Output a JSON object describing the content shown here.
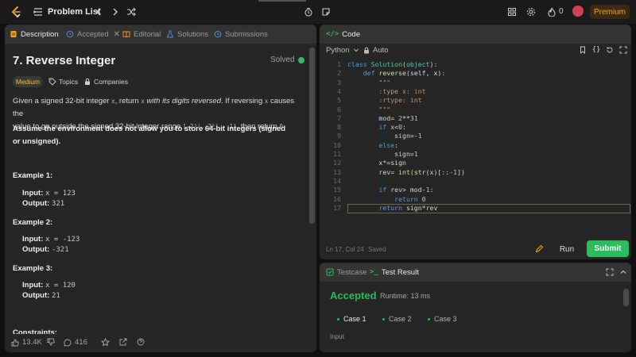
{
  "navbar": {
    "title": "Problem List",
    "streak_count": "0",
    "premium_label": "Premium"
  },
  "left_tabs": [
    {
      "label": "Description"
    },
    {
      "label": "Accepted"
    },
    {
      "label": "Editorial"
    },
    {
      "label": "Solutions"
    },
    {
      "label": "Submissions"
    }
  ],
  "problem": {
    "title": "7. Reverse Integer",
    "status": "Solved",
    "difficulty": "Medium",
    "topics_label": "Topics",
    "companies_label": "Companies",
    "desc_p1_a": "Given a signed 32-bit integer ",
    "desc_p1_x": "x",
    "desc_p1_b": ", return ",
    "desc_p1_x2": "x",
    "desc_p1_c": " with its digits reversed",
    "desc_p1_d": ". If reversing ",
    "desc_p1_x3": "x",
    "desc_p1_e": " causes the",
    "desc_p1_line2a": "value to go outside the signed 32-bit integer range ",
    "desc_p1_range": "[-2³¹, 2³¹ - 1]",
    "desc_p1_line2b": ", then return ",
    "desc_p1_zero": "0",
    "desc_p1_end": ".",
    "desc_p2": "Assume the environment does not allow you to store 64-bit integers (signed or unsigned).",
    "examples": [
      {
        "title": "Example 1:",
        "input": "x = 123",
        "output": "321"
      },
      {
        "title": "Example 2:",
        "input": "x = -123",
        "output": "-321"
      },
      {
        "title": "Example 3:",
        "input": "x = 120",
        "output": "21"
      }
    ],
    "input_label": "Input:",
    "output_label": "Output:",
    "constraints_label": "Constraints:"
  },
  "footer": {
    "likes": "13.4K",
    "comments": "416"
  },
  "editor": {
    "tab_label": "Code",
    "language": "Python",
    "mode": "Auto",
    "status_pos": "Ln 17, Col 24",
    "status_saved": "Saved",
    "run_label": "Run",
    "submit_label": "Submit",
    "code_lines": [
      "class Solution(object):",
      "    def reverse(self, x):",
      "        \"\"\"",
      "        :type x: int",
      "        :rtype: int",
      "        \"\"\"",
      "        mod= 2**31",
      "        if x<0:",
      "            sign=-1",
      "        else:",
      "            sign=1",
      "        x*=sign",
      "        rev= int(str(x)[::-1])",
      "",
      "        if rev> mod-1:",
      "            return 0",
      "        return sign*rev"
    ],
    "line_numbers": [
      "1",
      "2",
      "3",
      "4",
      "5",
      "6",
      "7",
      "8",
      "9",
      "10",
      "11",
      "12",
      "13",
      "14",
      "15",
      "16",
      "17"
    ]
  },
  "test": {
    "tab_testcase": "Testcase",
    "tab_result": "Test Result",
    "result": "Accepted",
    "runtime": "Runtime: 13 ms",
    "cases": [
      "Case 1",
      "Case 2",
      "Case 3"
    ],
    "input_label": "Input"
  },
  "colors": {
    "accent_green": "#2cbb5d",
    "medium_yellow": "#ffc01e",
    "premium_orange": "#ffa116"
  }
}
